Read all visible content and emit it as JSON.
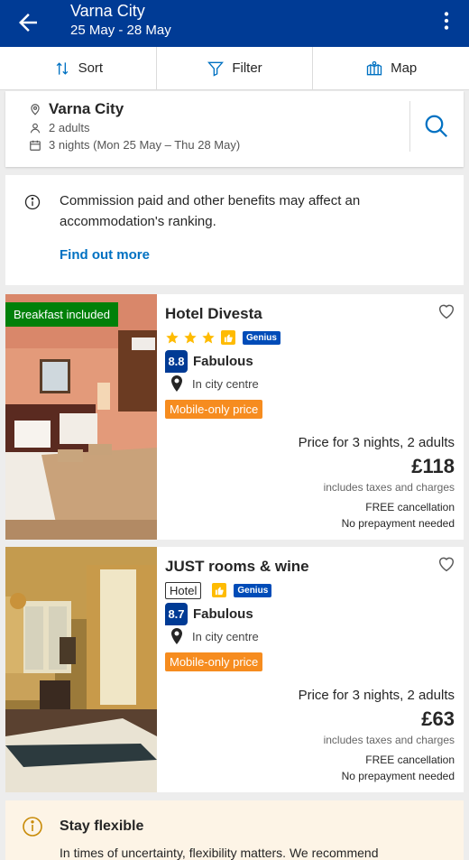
{
  "header": {
    "title": "Varna City",
    "dates": "25 May - 28 May"
  },
  "toolbar": {
    "sort": "Sort",
    "filter": "Filter",
    "map": "Map"
  },
  "search": {
    "destination": "Varna City",
    "guests": "2 adults",
    "stay": "3 nights (Mon 25 May – Thu 28 May)"
  },
  "notice": {
    "text": "Commission paid and other benefits may affect an accommodation's ranking.",
    "link": "Find out more"
  },
  "hotels": [
    {
      "name": "Hotel Divesta",
      "badge": "Breakfast included",
      "stars": 3,
      "genius": "Genius",
      "score": "8.8",
      "score_label": "Fabulous",
      "location": "In city centre",
      "deal": "Mobile-only price",
      "price_label": "Price for 3 nights, 2 adults",
      "price": "£118",
      "taxes": "includes taxes and charges",
      "cancellation": "FREE cancellation",
      "prepayment": "No prepayment needed"
    },
    {
      "name": "JUST rooms & wine",
      "type": "Hotel",
      "genius": "Genius",
      "score": "8.7",
      "score_label": "Fabulous",
      "location": "In city centre",
      "deal": "Mobile-only price",
      "price_label": "Price for 3 nights, 2 adults",
      "price": "£63",
      "taxes": "includes taxes and charges",
      "cancellation": "FREE cancellation",
      "prepayment": "No prepayment needed"
    }
  ],
  "flexible": {
    "title": "Stay flexible",
    "text": "In times of uncertainty, flexibility matters. We recommend"
  },
  "colors": {
    "brand": "#003b95",
    "link": "#0071c2",
    "breakfast": "#008009",
    "deal": "#f68c1f",
    "star": "#febb02"
  }
}
